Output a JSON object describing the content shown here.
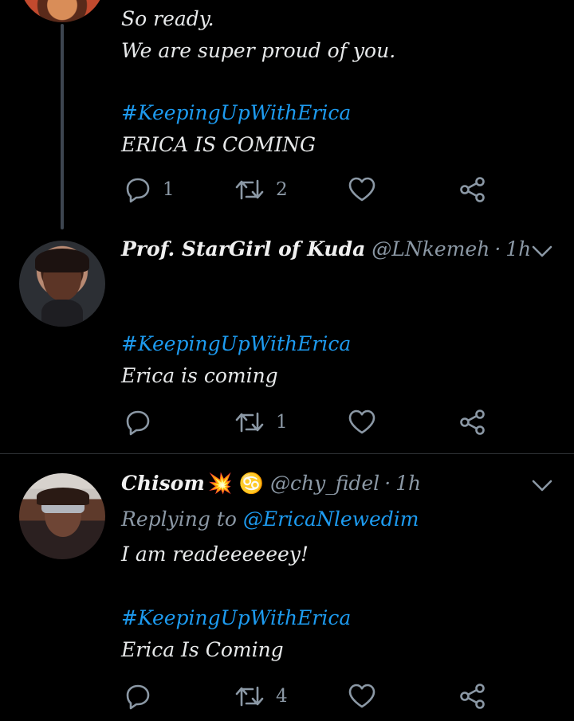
{
  "tweet1": {
    "lines": [
      "So ready.",
      "We are super proud of you.",
      "",
      "#KeepingUpWithErica",
      "ERICA IS COMING"
    ],
    "hashtag": "#KeepingUpWithErica",
    "line1": "So ready.",
    "line2": "We are super proud of you.",
    "line4": "ERICA IS COMING",
    "reply_count": "1",
    "retweet_count": "2"
  },
  "tweet2": {
    "name": "Prof. StarGirl of Kuda",
    "handle": "@LNkemeh",
    "time": "1h",
    "hashtag": "#KeepingUpWithErica",
    "line": "Erica is coming",
    "reply_count": "",
    "retweet_count": "1"
  },
  "tweet3": {
    "name": "Chisom",
    "name_emoji": "💥 ♋",
    "handle": "@chy_fidel",
    "time": "1h",
    "replying_prefix": "Replying to",
    "replying_to": "@EricaNlewedim",
    "line1": "I am readeeeeeey!",
    "hashtag": "#KeepingUpWithErica",
    "line2": "Erica Is Coming",
    "reply_count": "",
    "retweet_count": "4"
  },
  "colors": {
    "background": "#000000",
    "text": "#e7e9ea",
    "muted": "#8b98a5",
    "accent": "#1d9bf0",
    "divider": "#2f3336"
  },
  "icons": [
    "reply-icon",
    "retweet-icon",
    "like-icon",
    "share-icon",
    "chevron-down-icon"
  ]
}
